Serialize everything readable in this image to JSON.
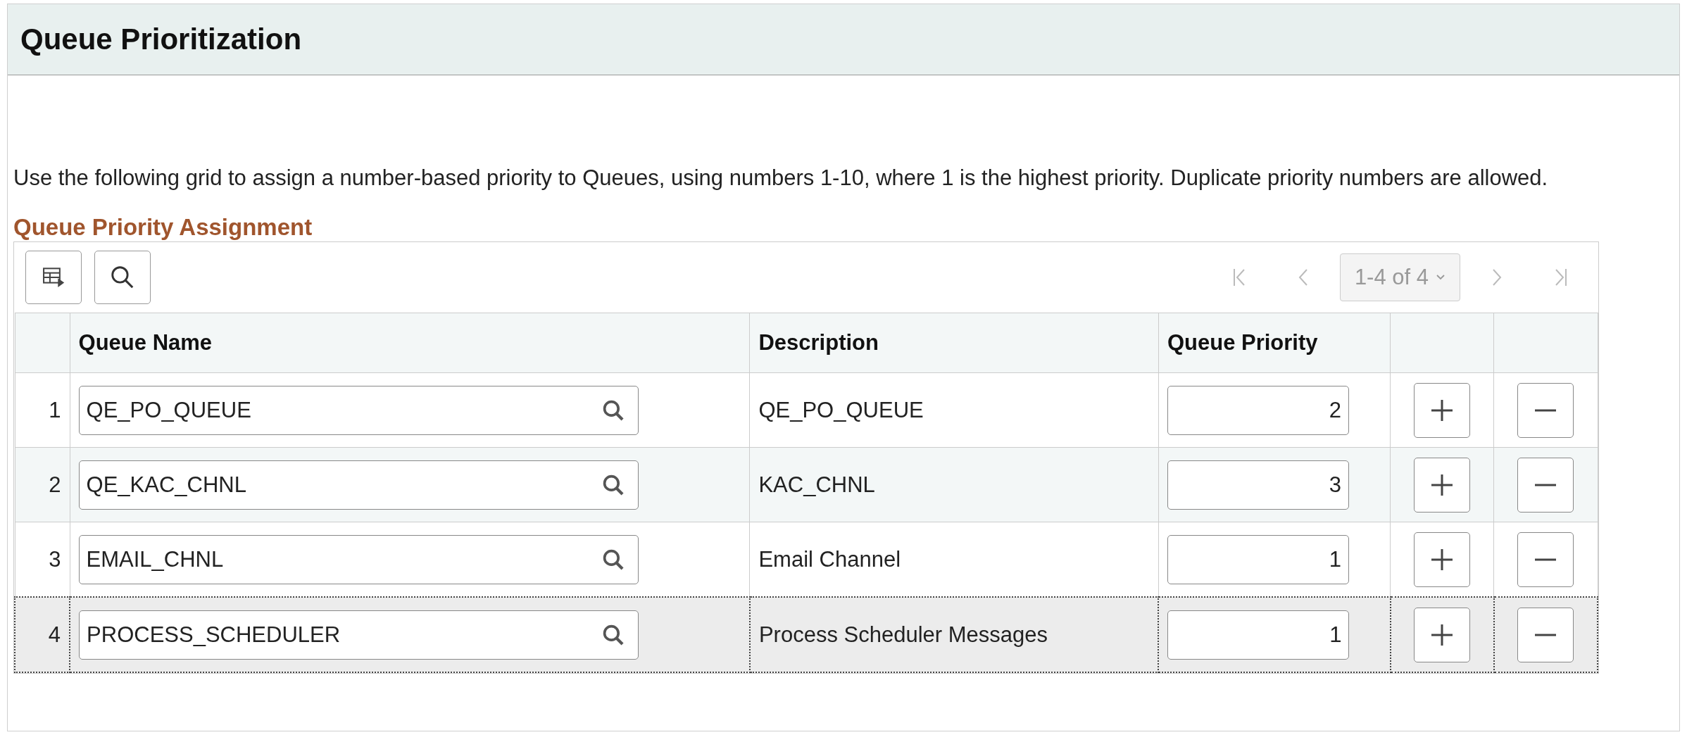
{
  "page_title": "Queue Prioritization",
  "instructions": "Use the following grid to assign a number-based priority to Queues, using numbers 1-10, where 1 is the highest priority. Duplicate priority numbers are allowed.",
  "section_title": "Queue Priority Assignment",
  "pager": {
    "range": "1-4 of 4"
  },
  "columns": [
    "Queue Name",
    "Description",
    "Queue Priority"
  ],
  "rows": [
    {
      "number": "1",
      "queue_name": "QE_PO_QUEUE",
      "description": "QE_PO_QUEUE",
      "priority": "2",
      "selected": false
    },
    {
      "number": "2",
      "queue_name": "QE_KAC_CHNL",
      "description": "KAC_CHNL",
      "priority": "3",
      "selected": false
    },
    {
      "number": "3",
      "queue_name": "EMAIL_CHNL",
      "description": "Email Channel",
      "priority": "1",
      "selected": false
    },
    {
      "number": "4",
      "queue_name": "PROCESS_SCHEDULER",
      "description": "Process Scheduler Messages",
      "priority": "1",
      "selected": true
    }
  ]
}
